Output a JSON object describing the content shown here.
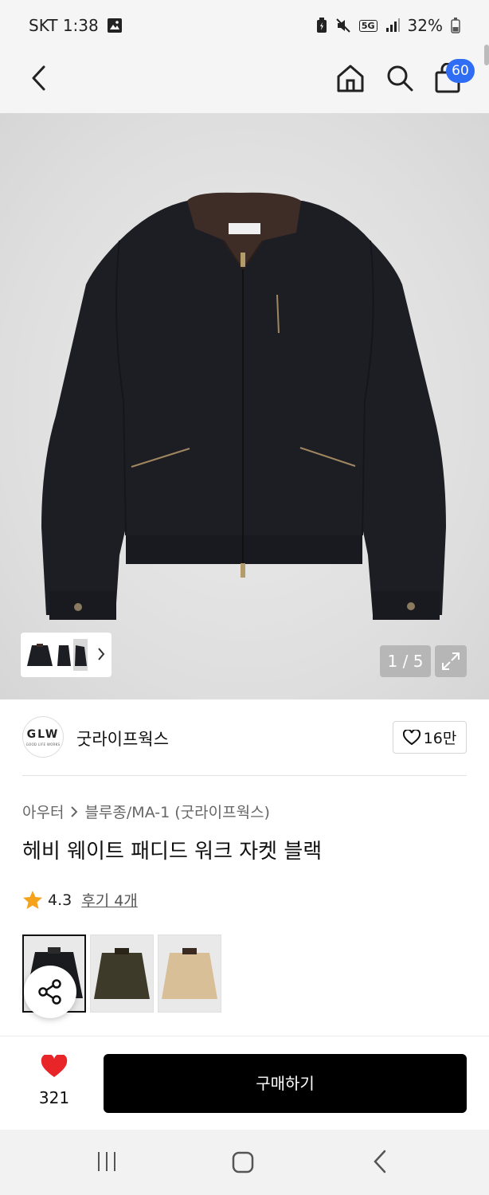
{
  "status_bar": {
    "time": "SKT 1:38",
    "battery": "32%",
    "network": "5G"
  },
  "nav": {
    "cart_count": "60"
  },
  "gallery": {
    "pager": "1 / 5",
    "main_image": "black work jacket with brown corduroy collar"
  },
  "brand": {
    "logo_text": "GLW",
    "logo_subtext": "GOOD LIFE WORKS",
    "name": "굿라이프웍스",
    "likes": "16만"
  },
  "product": {
    "breadcrumb": [
      "아우터",
      "블루종/MA-1 (굿라이프웍스)"
    ],
    "title": "헤비 웨이트 패디드 워크 자켓 블랙",
    "rating": "4.3",
    "reviews": "후기 4개"
  },
  "swatches": [
    {
      "color": "#1a1b1f",
      "collar": "#2a2a2a"
    },
    {
      "color": "#3d3a29",
      "collar": "#2a2318"
    },
    {
      "color": "#d9bf98",
      "collar": "#3b2a22"
    }
  ],
  "bottom_bar": {
    "wish_count": "321",
    "buy_label": "구매하기"
  },
  "colors": {
    "accent_badge": "#2f6df5",
    "heart": "#e8262a",
    "star": "#f5a31a",
    "buy_button": "#000000"
  }
}
